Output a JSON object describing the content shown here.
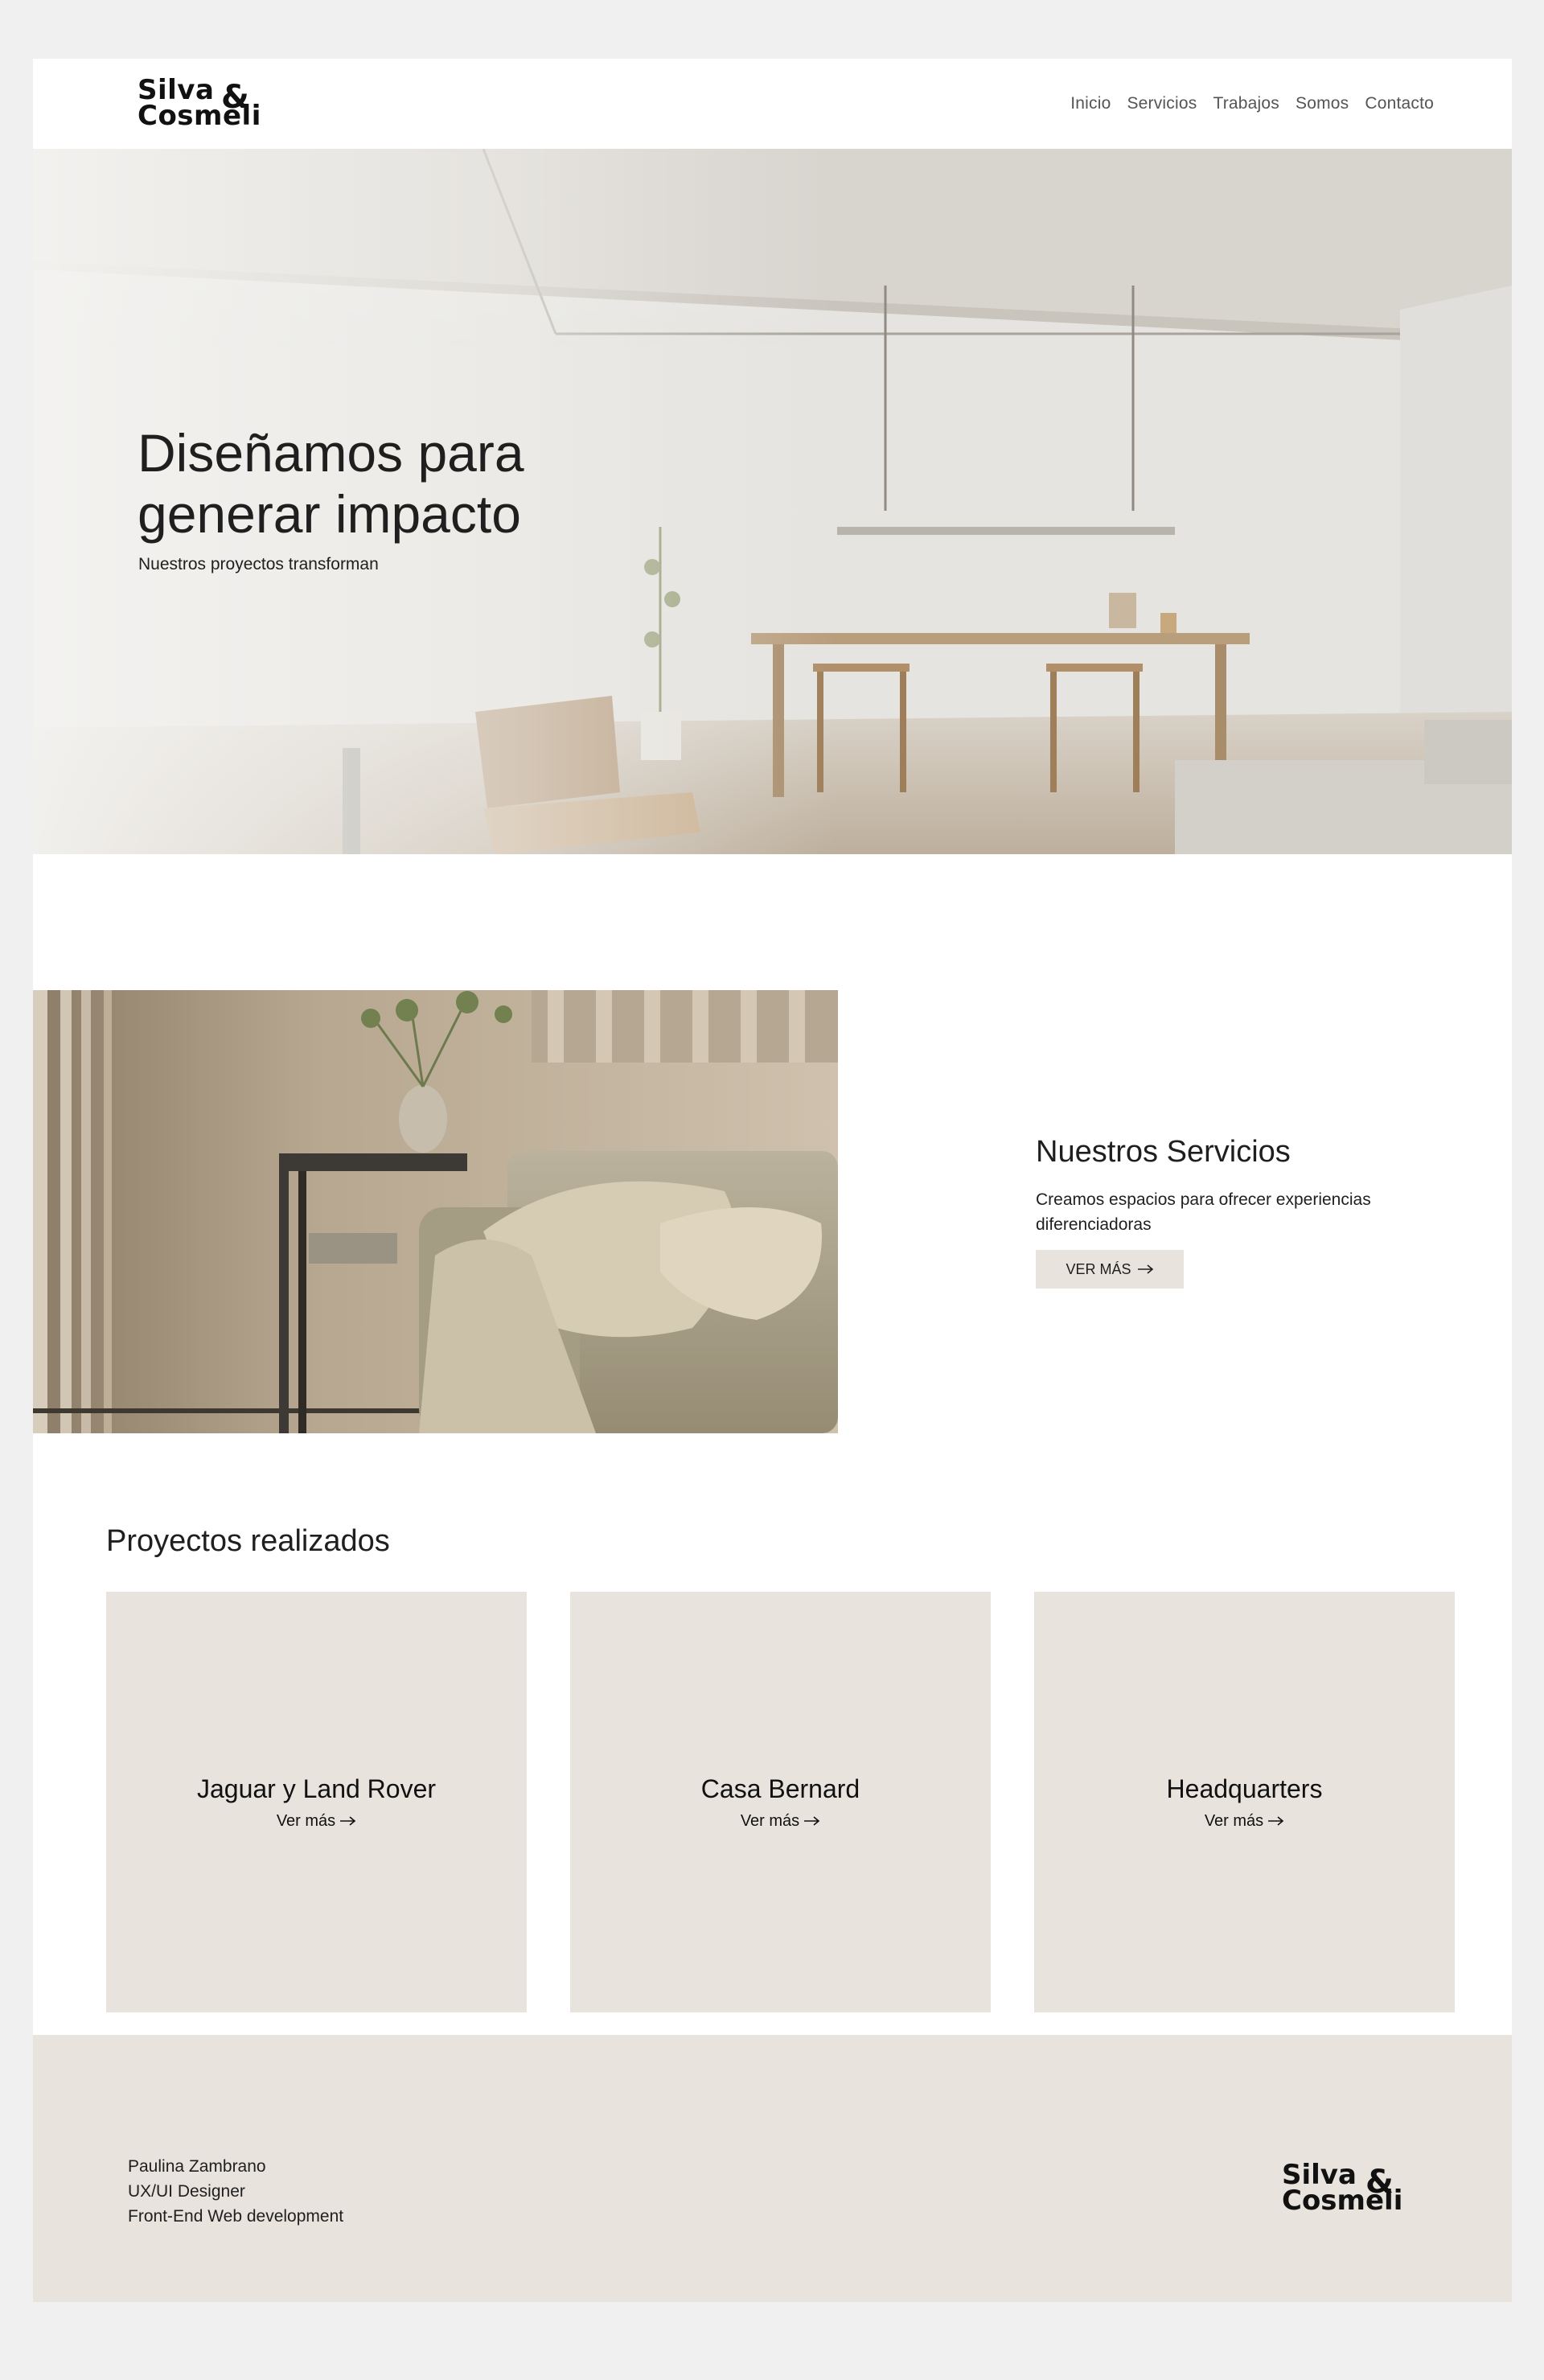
{
  "brand": {
    "logo_line1": "Silva",
    "logo_line2": "Cosmeli",
    "logo_amp": "&"
  },
  "nav": {
    "items": [
      "Inicio",
      "Servicios",
      "Trabajos",
      "Somos",
      "Contacto"
    ]
  },
  "hero": {
    "title": "Diseñamos para generar impacto",
    "subtitle": "Nuestros proyectos transforman"
  },
  "services": {
    "title": "Nuestros Servicios",
    "description": "Creamos espacios para ofrecer experiencias diferenciadoras",
    "button_label": "VER MÁS",
    "button_icon": "arrow-right-icon"
  },
  "projects": {
    "title": "Proyectos realizados",
    "cards": [
      {
        "title": "Jaguar y Land Rover",
        "link": "Ver más"
      },
      {
        "title": "Casa Bernard",
        "link": "Ver más"
      },
      {
        "title": "Headquarters",
        "link": "Ver más"
      }
    ]
  },
  "footer": {
    "lines": [
      "Paulina Zambrano",
      "UX/UI Designer",
      "Front-End Web development"
    ]
  },
  "colors": {
    "page_bg": "#f0f0f0",
    "beige": "#e8e3dc",
    "text": "#1f1f1f",
    "nav_text": "#555555"
  }
}
